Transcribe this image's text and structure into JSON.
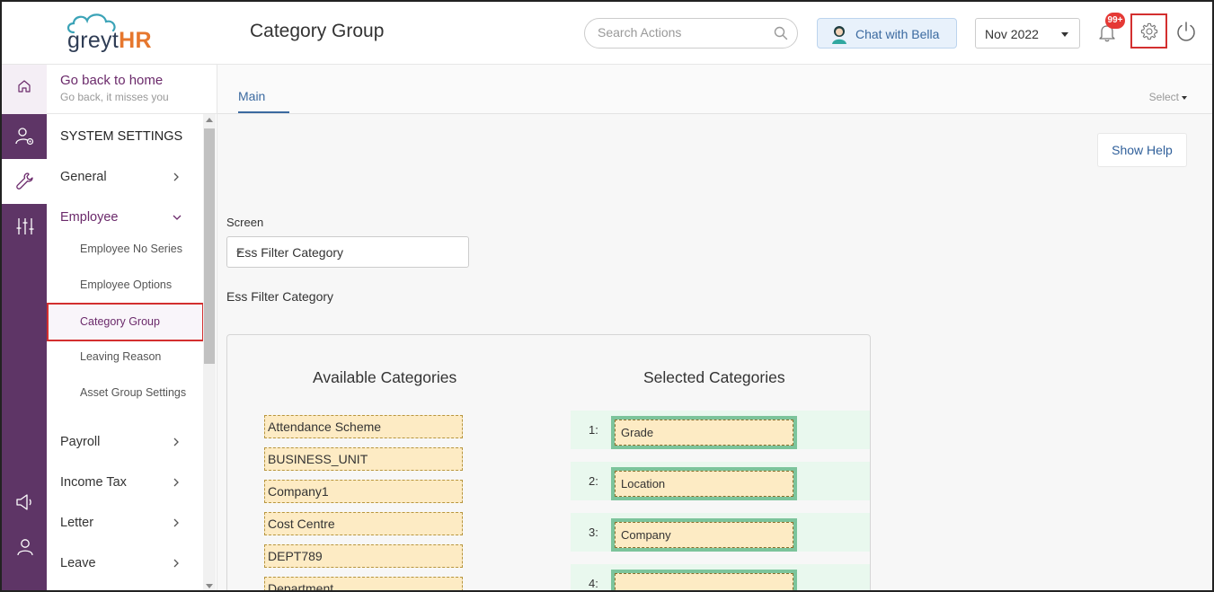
{
  "header": {
    "logo_prefix": "greyt",
    "logo_suffix": "HR",
    "page_title": "Category Group",
    "search_placeholder": "Search Actions",
    "chat_label": "Chat with Bella",
    "period": "Nov 2022",
    "notification_count": "99+"
  },
  "sidebar": {
    "go_back_title": "Go back to home",
    "go_back_subtitle": "Go back, it misses you",
    "section_heading": "SYSTEM SETTINGS",
    "items": [
      {
        "label": "General"
      },
      {
        "label": "Employee"
      },
      {
        "label": "Payroll"
      },
      {
        "label": "Income Tax"
      },
      {
        "label": "Letter"
      },
      {
        "label": "Leave"
      }
    ],
    "employee_subitems": [
      {
        "label": "Employee No Series"
      },
      {
        "label": "Employee Options"
      },
      {
        "label": "Category Group"
      },
      {
        "label": "Leaving Reason"
      },
      {
        "label": "Asset Group Settings"
      }
    ]
  },
  "main": {
    "tab": "Main",
    "select_menu": "Select",
    "show_help": "Show Help",
    "screen_label": "Screen",
    "screen_value": "Ess Filter Category",
    "section_title": "Ess Filter Category",
    "available_title": "Available Categories",
    "selected_title": "Selected Categories",
    "available": [
      "Attendance Scheme",
      "BUSINESS_UNIT",
      "Company1",
      "Cost Centre",
      "DEPT789",
      "Department"
    ],
    "selected": [
      {
        "num": "1:",
        "label": "Grade"
      },
      {
        "num": "2:",
        "label": "Location"
      },
      {
        "num": "3:",
        "label": "Company"
      },
      {
        "num": "4:",
        "label": ""
      }
    ]
  },
  "colors": {
    "brand_purple": "#5e3566",
    "accent_blue": "#3b6aa0",
    "logo_orange": "#e6772e",
    "highlight_red": "#d32f2f",
    "category_chip": "#fdebc4",
    "selected_slot": "#7cc49b"
  }
}
